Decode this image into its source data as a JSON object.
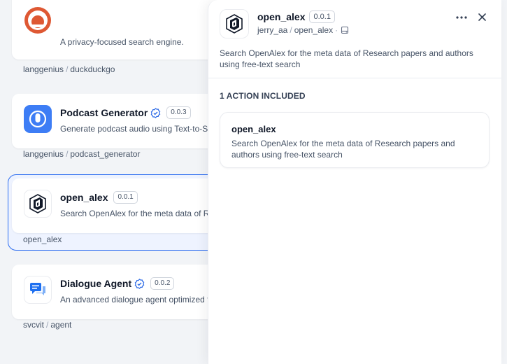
{
  "plugins": [
    {
      "name": "",
      "description": "A privacy-focused search engine.",
      "author": "langgenius",
      "package": "duckduckgo",
      "icon": "duckduckgo-icon"
    },
    {
      "name": "Podcast Generator",
      "verified": true,
      "version": "0.0.3",
      "description": "Generate podcast audio using Text-to-Sp",
      "author": "langgenius",
      "package": "podcast_generator",
      "icon": "microphone-icon",
      "accent": "#3d7df5"
    },
    {
      "name": "open_alex",
      "version": "0.0.1",
      "description": "Search OpenAlex for the meta data of Re",
      "package": "open_alex",
      "icon": "open-alex-logo-icon",
      "selected": true
    },
    {
      "name": "Dialogue Agent",
      "verified": true,
      "version": "0.0.2",
      "description": "An advanced dialogue agent optimized f",
      "author": "svcvit",
      "package": "agent",
      "icon": "chat-bubbles-icon",
      "accent": "#1e6ff0"
    }
  ],
  "drawer": {
    "title": "open_alex",
    "version": "0.0.1",
    "author": "jerry_aa",
    "package": "open_alex",
    "description": "Search OpenAlex for the meta data of Research papers and authors using free-text search",
    "section_title": "1 ACTION INCLUDED",
    "actions": [
      {
        "name": "open_alex",
        "description": "Search OpenAlex for the meta data of Research papers and authors using free-text search"
      }
    ]
  },
  "colors": {
    "selected_border": "#2d6df0",
    "verified": "#2e6be6"
  }
}
